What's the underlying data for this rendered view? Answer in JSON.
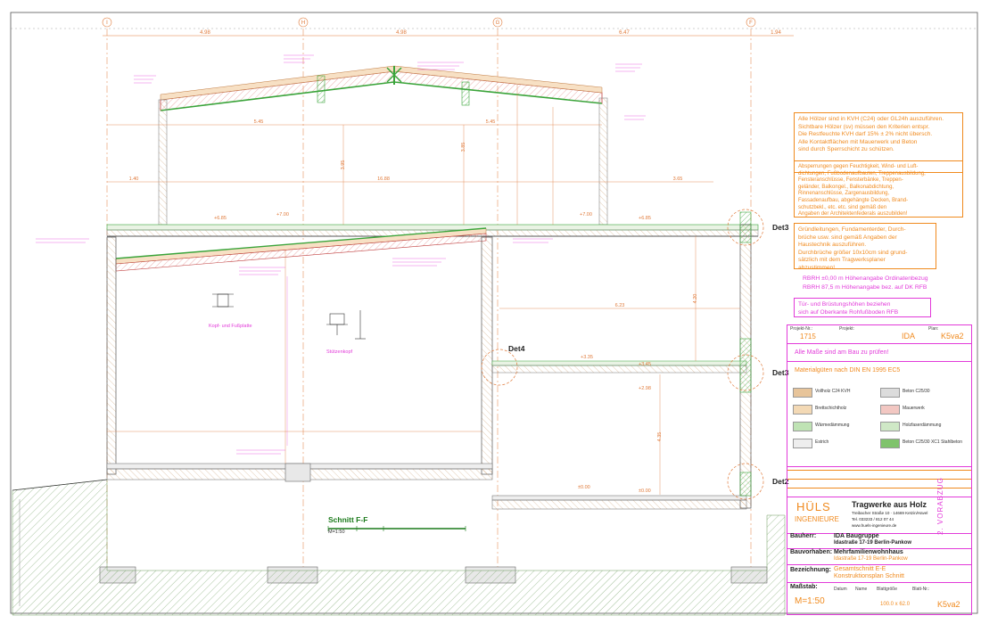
{
  "grid": {
    "axes": [
      "I",
      "H",
      "G",
      "F"
    ]
  },
  "dimensions_top": [
    "4.98",
    "4.98",
    "6.47",
    "1.94"
  ],
  "plan_annotations": {
    "dims": [
      "5.45",
      "5.45",
      "1.40",
      "16.88",
      "3.65",
      "3.95",
      "3.85",
      "6.23",
      "4.35",
      "4.20"
    ],
    "levels": [
      "+6.85",
      "+7.00",
      "+7.00",
      "+6.85",
      "+3.35",
      "+3.45",
      "+2.98",
      "±0.00",
      "±0.00"
    ],
    "stutzen_label": "Stützenkopf",
    "kopf_label": "Kopf- und Fußplatte"
  },
  "details": [
    "Det3",
    "Det3",
    "Det4",
    "Det2"
  ],
  "section": {
    "title": "Schnitt F-F",
    "scale": "M=1:50"
  },
  "notes": {
    "box1": [
      "Alle Hölzer sind in KVH (C24) oder GL24h auszuführen.",
      "Sichtbare Hölzer (sv) müssen den Kriterien entspr.",
      "Die Restfeuchte KVH darf 15% ± 2% nicht übersch.",
      "Alle Kontaktflächen mit Mauerwerk und Beton",
      "sind durch Sperrschicht zu schützen."
    ],
    "box2": [
      "Absperrungen gegen Feuchtigkeit, Wind- und Luft-",
      "dichtungen, Fußbodenaufbauten, Treppenausbildung,",
      "Fensteranschlüsse, Fensterbänke, Treppen-",
      "geländer, Balkongel., Balkonabdichtung,",
      "Rinnenanschlüsse, Zargenausbildung,",
      "Fassadenaufbau, abgehängte Decken, Brand-",
      "schutzbekl., etc. etc. sind gemäß den",
      "Angaben der Architektenfederals auszubilden!"
    ],
    "box3": [
      "Gründleitungen, Fundamenterder, Durch-",
      "brüche usw. sind gemäß Angaben der",
      "Haustechnik auszuführen.",
      "Durchbrüche größer 10x10cm sind grund-",
      "sätzlich mit dem Tragwerksplaner",
      "abzustimmen!"
    ],
    "height1": "RBRH ±0,00 m Höhenangabe Ordinatenbezug",
    "height2": "RBRH 87,5 m Höhenangabe bez. auf DK RFB",
    "door_note": [
      "Tür- und Brüstungshöhen beziehen",
      "sich auf Oberkante Rohfußboden RFB"
    ]
  },
  "titleblock": {
    "proj_label": "Projekt-Nr.:",
    "proj_nr": "1715",
    "proj_name_label": "Projekt:",
    "proj_name": "IDA",
    "plan_label": "Plan:",
    "plan_nr": "K5va2",
    "check_note": "Alle Maße sind am Bau zu prüfen!",
    "material_title": "Materialgüten nach DIN EN 1995 EC5",
    "material_items": [
      {
        "label": "Vollholz C24 KVH",
        "hatch": "#e7c49a"
      },
      {
        "label": "Brettschichtholz",
        "hatch": "#f3d9b5"
      },
      {
        "label": "Wärmedämmung",
        "hatch": "#bfe3b4"
      },
      {
        "label": "Estrich",
        "hatch": "#eeeeee"
      },
      {
        "label": "Beton C25/30",
        "hatch": "#dcdcdc"
      },
      {
        "label": "Mauerwerk",
        "hatch": "#f2c7c2"
      },
      {
        "label": "Holzfaserdämmung",
        "hatch": "#cfe8c6"
      },
      {
        "label": "Beton C25/30 XC1 Stahlbeton",
        "hatch": "#7fc36b"
      }
    ],
    "company_name": "Tragwerke aus Holz",
    "company_logo": "HÜLS",
    "company_sub": "INGENIEURE",
    "company_address": "Treibacher Straße 10 · 14669 Ketzin/Havel",
    "company_contact": [
      "Tel. 033233 / 812 07 44",
      "www.huels-ingenieure.de"
    ],
    "bauherr_label": "Bauherr:",
    "bauherr": "IDA Baugruppe",
    "bauherr_addr": "Idastraße 17-19  Berlin-Pankow",
    "bauvorhaben_label": "Bauvorhaben:",
    "bauvorhaben": "Mehrfamilienwohnhaus",
    "bauvorhaben_addr": "Idastraße 17-19 Berlin-Pankow",
    "bezeichnung_label": "Bezeichnung:",
    "bezeichnung1": "Gesamtschnitt E-E",
    "bezeichnung2": "Konstruktionsplan Schnitt",
    "massstab_label": "Maßstab:",
    "massstab": "M=1:50",
    "vorabzug": "2. VORABZUG",
    "cols": [
      "Datum",
      "Name",
      "Blattgröße",
      "Blatt-Nr.:"
    ],
    "blattgroesse": "100.0 x 62.0",
    "blattnr": "K5va2"
  }
}
